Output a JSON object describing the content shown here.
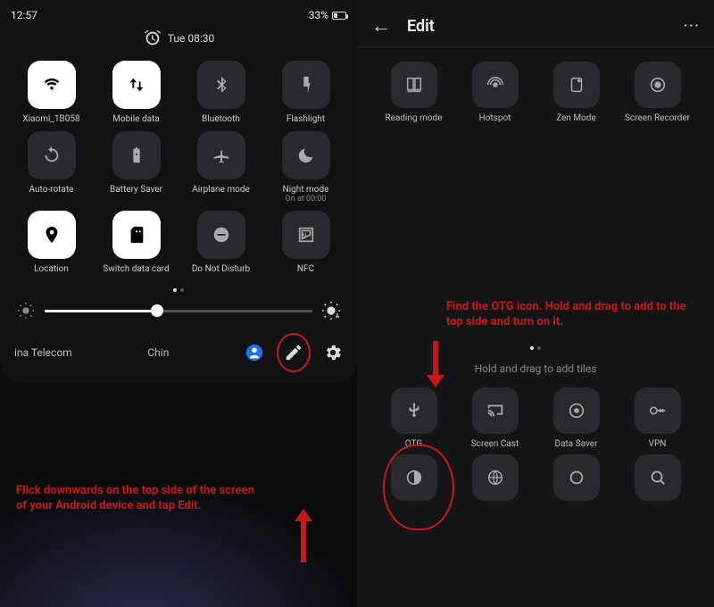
{
  "left": {
    "status": {
      "time": "12:57",
      "battery": "33%"
    },
    "alarm": "Tue 08:30",
    "tiles": [
      {
        "label": "Xiaomi_1B058",
        "icon": "wifi",
        "on": true,
        "sub": ""
      },
      {
        "label": "Mobile data",
        "icon": "data",
        "on": true,
        "sub": ""
      },
      {
        "label": "Bluetooth",
        "icon": "bluetooth",
        "on": false,
        "sub": ""
      },
      {
        "label": "Flashlight",
        "icon": "flash",
        "on": false,
        "sub": ""
      },
      {
        "label": "Auto-rotate",
        "icon": "rotate",
        "on": false,
        "sub": ""
      },
      {
        "label": "Battery Saver",
        "icon": "batt",
        "on": false,
        "sub": ""
      },
      {
        "label": "Airplane mode",
        "icon": "plane",
        "on": false,
        "sub": ""
      },
      {
        "label": "Night mode",
        "icon": "moon",
        "on": false,
        "sub": "On at 00:00"
      },
      {
        "label": "Location",
        "icon": "pin",
        "on": true,
        "sub": ""
      },
      {
        "label": "Switch data card",
        "icon": "sim",
        "on": true,
        "sub": ""
      },
      {
        "label": "Do Not Disturb",
        "icon": "dnd",
        "on": false,
        "sub": ""
      },
      {
        "label": "NFC",
        "icon": "nfc",
        "on": false,
        "sub": ""
      }
    ],
    "carriers": [
      "ina Telecom",
      "Chin"
    ],
    "callout": "Flick downwards on the top side of the screen of your Android device and tap Edit."
  },
  "right": {
    "title": "Edit",
    "top_tiles": [
      {
        "label": "Reading mode",
        "icon": "book"
      },
      {
        "label": "Hotspot",
        "icon": "hotspot"
      },
      {
        "label": "Zen Mode",
        "icon": "zen"
      },
      {
        "label": "Screen Recorder",
        "icon": "rec"
      }
    ],
    "hint": "Hold and drag to add tiles",
    "bottom_tiles": [
      {
        "label": "OTG",
        "icon": "usb"
      },
      {
        "label": "Screen Cast",
        "icon": "cast"
      },
      {
        "label": "Data Saver",
        "icon": "disc"
      },
      {
        "label": "VPN",
        "icon": "key"
      }
    ],
    "extra_tiles": [
      {
        "label": "",
        "icon": "invert"
      },
      {
        "label": "",
        "icon": "globe"
      },
      {
        "label": "",
        "icon": "ring"
      },
      {
        "label": "",
        "icon": "search"
      }
    ],
    "callout": "Find the OTG icon. Hold and drag to add to the top side and turn on it."
  }
}
